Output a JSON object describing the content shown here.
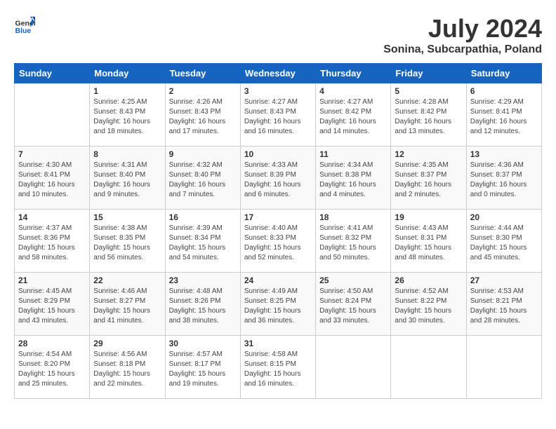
{
  "header": {
    "logo_general": "General",
    "logo_blue": "Blue",
    "month_year": "July 2024",
    "location": "Sonina, Subcarpathia, Poland"
  },
  "days_of_week": [
    "Sunday",
    "Monday",
    "Tuesday",
    "Wednesday",
    "Thursday",
    "Friday",
    "Saturday"
  ],
  "weeks": [
    [
      {
        "day": "",
        "info": ""
      },
      {
        "day": "1",
        "info": "Sunrise: 4:25 AM\nSunset: 8:43 PM\nDaylight: 16 hours\nand 18 minutes."
      },
      {
        "day": "2",
        "info": "Sunrise: 4:26 AM\nSunset: 8:43 PM\nDaylight: 16 hours\nand 17 minutes."
      },
      {
        "day": "3",
        "info": "Sunrise: 4:27 AM\nSunset: 8:43 PM\nDaylight: 16 hours\nand 16 minutes."
      },
      {
        "day": "4",
        "info": "Sunrise: 4:27 AM\nSunset: 8:42 PM\nDaylight: 16 hours\nand 14 minutes."
      },
      {
        "day": "5",
        "info": "Sunrise: 4:28 AM\nSunset: 8:42 PM\nDaylight: 16 hours\nand 13 minutes."
      },
      {
        "day": "6",
        "info": "Sunrise: 4:29 AM\nSunset: 8:41 PM\nDaylight: 16 hours\nand 12 minutes."
      }
    ],
    [
      {
        "day": "7",
        "info": "Sunrise: 4:30 AM\nSunset: 8:41 PM\nDaylight: 16 hours\nand 10 minutes."
      },
      {
        "day": "8",
        "info": "Sunrise: 4:31 AM\nSunset: 8:40 PM\nDaylight: 16 hours\nand 9 minutes."
      },
      {
        "day": "9",
        "info": "Sunrise: 4:32 AM\nSunset: 8:40 PM\nDaylight: 16 hours\nand 7 minutes."
      },
      {
        "day": "10",
        "info": "Sunrise: 4:33 AM\nSunset: 8:39 PM\nDaylight: 16 hours\nand 6 minutes."
      },
      {
        "day": "11",
        "info": "Sunrise: 4:34 AM\nSunset: 8:38 PM\nDaylight: 16 hours\nand 4 minutes."
      },
      {
        "day": "12",
        "info": "Sunrise: 4:35 AM\nSunset: 8:37 PM\nDaylight: 16 hours\nand 2 minutes."
      },
      {
        "day": "13",
        "info": "Sunrise: 4:36 AM\nSunset: 8:37 PM\nDaylight: 16 hours\nand 0 minutes."
      }
    ],
    [
      {
        "day": "14",
        "info": "Sunrise: 4:37 AM\nSunset: 8:36 PM\nDaylight: 15 hours\nand 58 minutes."
      },
      {
        "day": "15",
        "info": "Sunrise: 4:38 AM\nSunset: 8:35 PM\nDaylight: 15 hours\nand 56 minutes."
      },
      {
        "day": "16",
        "info": "Sunrise: 4:39 AM\nSunset: 8:34 PM\nDaylight: 15 hours\nand 54 minutes."
      },
      {
        "day": "17",
        "info": "Sunrise: 4:40 AM\nSunset: 8:33 PM\nDaylight: 15 hours\nand 52 minutes."
      },
      {
        "day": "18",
        "info": "Sunrise: 4:41 AM\nSunset: 8:32 PM\nDaylight: 15 hours\nand 50 minutes."
      },
      {
        "day": "19",
        "info": "Sunrise: 4:43 AM\nSunset: 8:31 PM\nDaylight: 15 hours\nand 48 minutes."
      },
      {
        "day": "20",
        "info": "Sunrise: 4:44 AM\nSunset: 8:30 PM\nDaylight: 15 hours\nand 45 minutes."
      }
    ],
    [
      {
        "day": "21",
        "info": "Sunrise: 4:45 AM\nSunset: 8:29 PM\nDaylight: 15 hours\nand 43 minutes."
      },
      {
        "day": "22",
        "info": "Sunrise: 4:46 AM\nSunset: 8:27 PM\nDaylight: 15 hours\nand 41 minutes."
      },
      {
        "day": "23",
        "info": "Sunrise: 4:48 AM\nSunset: 8:26 PM\nDaylight: 15 hours\nand 38 minutes."
      },
      {
        "day": "24",
        "info": "Sunrise: 4:49 AM\nSunset: 8:25 PM\nDaylight: 15 hours\nand 36 minutes."
      },
      {
        "day": "25",
        "info": "Sunrise: 4:50 AM\nSunset: 8:24 PM\nDaylight: 15 hours\nand 33 minutes."
      },
      {
        "day": "26",
        "info": "Sunrise: 4:52 AM\nSunset: 8:22 PM\nDaylight: 15 hours\nand 30 minutes."
      },
      {
        "day": "27",
        "info": "Sunrise: 4:53 AM\nSunset: 8:21 PM\nDaylight: 15 hours\nand 28 minutes."
      }
    ],
    [
      {
        "day": "28",
        "info": "Sunrise: 4:54 AM\nSunset: 8:20 PM\nDaylight: 15 hours\nand 25 minutes."
      },
      {
        "day": "29",
        "info": "Sunrise: 4:56 AM\nSunset: 8:18 PM\nDaylight: 15 hours\nand 22 minutes."
      },
      {
        "day": "30",
        "info": "Sunrise: 4:57 AM\nSunset: 8:17 PM\nDaylight: 15 hours\nand 19 minutes."
      },
      {
        "day": "31",
        "info": "Sunrise: 4:58 AM\nSunset: 8:15 PM\nDaylight: 15 hours\nand 16 minutes."
      },
      {
        "day": "",
        "info": ""
      },
      {
        "day": "",
        "info": ""
      },
      {
        "day": "",
        "info": ""
      }
    ]
  ]
}
